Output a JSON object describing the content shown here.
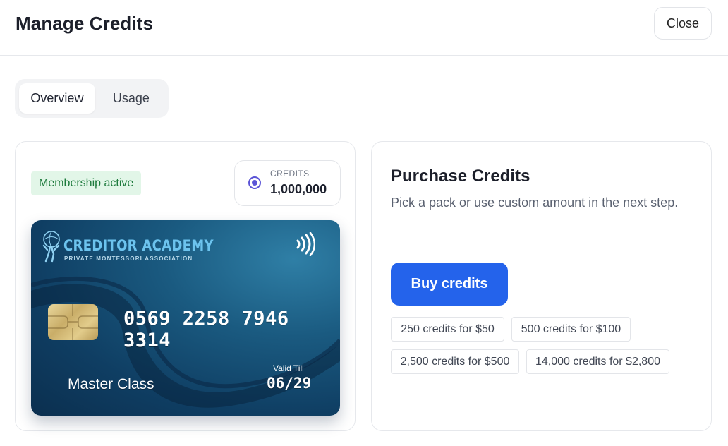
{
  "header": {
    "title": "Manage Credits",
    "close_label": "Close"
  },
  "tabs": [
    {
      "label": "Overview",
      "active": true
    },
    {
      "label": "Usage",
      "active": false
    }
  ],
  "membership": {
    "badge": "Membership active"
  },
  "credits": {
    "label": "CREDITS",
    "value": "1,000,000",
    "icon": "radio-icon"
  },
  "card": {
    "brand": "CREDITOR ACADEMY",
    "tagline": "PRIVATE MONTESSORI ASSOCIATION",
    "number": "0569 2258 7946 3314",
    "name": "Master Class",
    "valid_label": "Valid Till",
    "valid_date": "06/29",
    "icons": [
      "atlas-logo-icon",
      "contactless-icon",
      "chip-icon"
    ]
  },
  "purchase": {
    "title": "Purchase Credits",
    "description": "Pick a pack or use custom amount in the next step.",
    "buy_label": "Buy credits",
    "packs": [
      "250 credits for $50",
      "500 credits for $100",
      "2,500 credits for $500",
      "14,000 credits for $2,800"
    ]
  },
  "colors": {
    "accent": "#2463eb",
    "badge_bg": "#e2f6e8",
    "badge_text": "#1d7a3c",
    "radio": "#5b54d6"
  }
}
